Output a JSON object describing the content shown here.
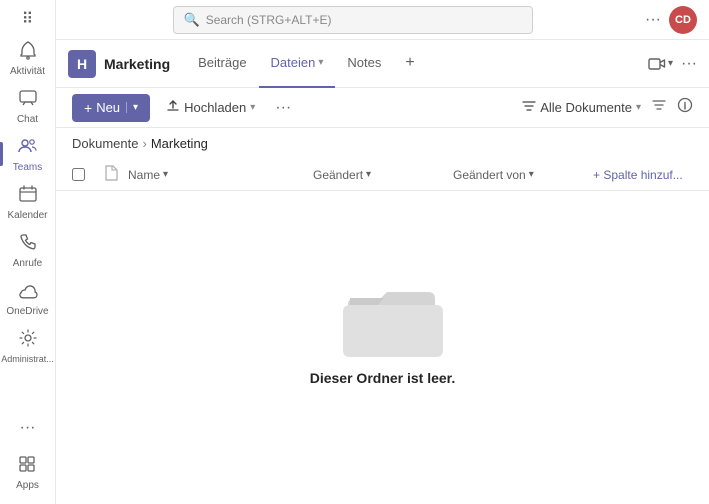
{
  "search": {
    "placeholder": "Search (STRG+ALT+E)"
  },
  "topbar": {
    "more_label": "···",
    "avatar_initials": "CD"
  },
  "sidebar": {
    "items": [
      {
        "id": "aktivitat",
        "label": "Aktivität",
        "icon": "🔔"
      },
      {
        "id": "chat",
        "label": "Chat",
        "icon": "💬"
      },
      {
        "id": "teams",
        "label": "Teams",
        "icon": "👥",
        "active": true
      },
      {
        "id": "kalender",
        "label": "Kalender",
        "icon": "📅"
      },
      {
        "id": "anrufe",
        "label": "Anrufe",
        "icon": "📞"
      },
      {
        "id": "onedrive",
        "label": "OneDrive",
        "icon": "☁"
      },
      {
        "id": "administrat",
        "label": "Administrat...",
        "icon": "⚙"
      }
    ],
    "more_label": "···",
    "apps_label": "Apps"
  },
  "channel": {
    "team_icon": "H",
    "team_name": "Marketing",
    "tabs": [
      {
        "id": "beitrage",
        "label": "Beiträge",
        "active": false
      },
      {
        "id": "dateien",
        "label": "Dateien",
        "active": true,
        "has_arrow": true
      },
      {
        "id": "notes",
        "label": "Notes",
        "active": false
      }
    ],
    "add_tab_icon": "+"
  },
  "toolbar": {
    "new_label": "Neu",
    "upload_label": "Hochladen",
    "more_label": "···",
    "all_docs_label": "Alle Dokumente"
  },
  "breadcrumb": {
    "root": "Dokumente",
    "separator": "›",
    "current": "Marketing"
  },
  "table": {
    "col_name": "Name",
    "col_modified": "Geändert",
    "col_modified_by": "Geändert von",
    "col_add": "+ Spalte hinzuf..."
  },
  "empty_state": {
    "message": "Dieser Ordner ist leer."
  }
}
